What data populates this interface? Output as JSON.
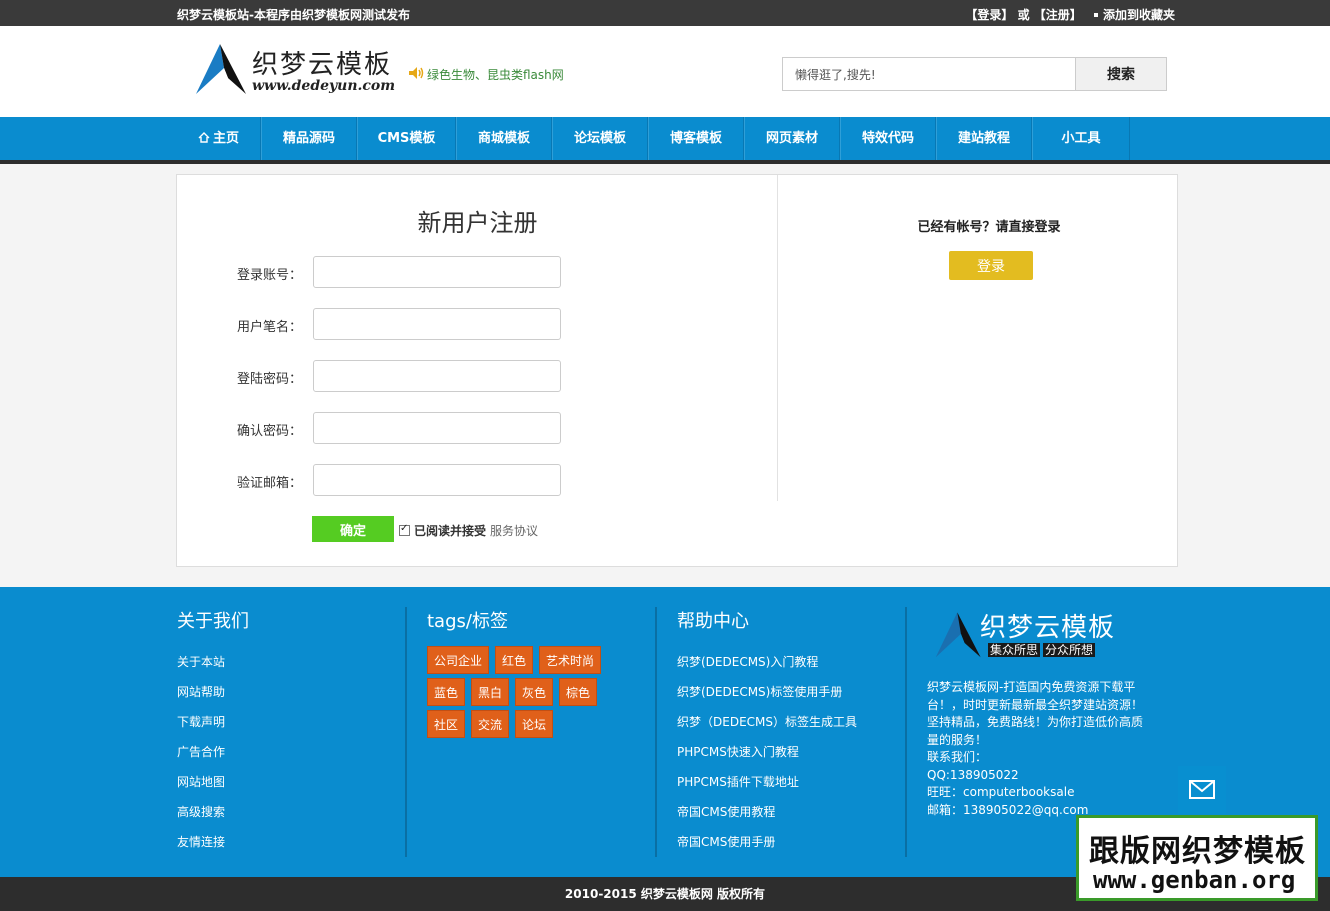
{
  "topbar": {
    "notice": "织梦云模板站-本程序由织梦模板网测试发布",
    "login": "【登录】",
    "or": "或",
    "register": "【注册】",
    "bookmark": "添加到收藏夹"
  },
  "header": {
    "logo_cn": "织梦云模板",
    "logo_en": "www.dedeyun.com",
    "marquee": "绿色生物、昆虫类flash网",
    "search_value": "懒得逛了,搜先!",
    "search_button": "搜索"
  },
  "nav": {
    "items": [
      {
        "label": "主页"
      },
      {
        "label": "精品源码"
      },
      {
        "label": "CMS模板"
      },
      {
        "label": "商城模板"
      },
      {
        "label": "论坛模板"
      },
      {
        "label": "博客模板"
      },
      {
        "label": "网页素材"
      },
      {
        "label": "特效代码"
      },
      {
        "label": "建站教程"
      },
      {
        "label": "小工具"
      }
    ]
  },
  "register": {
    "title": "新用户注册",
    "fields": [
      {
        "label": "登录账号："
      },
      {
        "label": "用户笔名："
      },
      {
        "label": "登陆密码："
      },
      {
        "label": "确认密码："
      },
      {
        "label": "验证邮箱："
      }
    ],
    "submit": "确定",
    "agree": "已阅读并接受",
    "tos": "服务协议"
  },
  "login": {
    "question": "已经有帐号？请直接登录",
    "button": "登录"
  },
  "footer": {
    "about": {
      "title": "关于我们",
      "links": [
        "关于本站",
        "网站帮助",
        "下载声明",
        "广告合作",
        "网站地图",
        "高级搜索",
        "友情连接"
      ]
    },
    "tags": {
      "title": "tags/标签",
      "items": [
        "公司企业",
        "红色",
        "艺术时尚",
        "蓝色",
        "黑白",
        "灰色",
        "棕色",
        "社区",
        "交流",
        "论坛"
      ]
    },
    "help": {
      "title": "帮助中心",
      "links": [
        "织梦(DEDECMS)入门教程",
        "织梦(DEDECMS)标签使用手册",
        "织梦（DEDECMS）标签生成工具",
        "PHPCMS快速入门教程",
        "PHPCMS插件下载地址",
        "帝国CMS使用教程",
        "帝国CMS使用手册"
      ]
    },
    "brand": {
      "logo_cn": "织梦云模板",
      "slogan_a": "集众所思",
      "slogan_b": "分众所想",
      "lines": [
        "织梦云模板网-打造国内免费资源下载平台！，时时更新最新最全织梦建站资源！坚持精品，免费路线！为你打造低价高质量的服务！",
        "联系我们：",
        "QQ:138905022",
        "旺旺：computerbooksale",
        "邮箱：138905022@qq.com"
      ]
    }
  },
  "watermark": {
    "line1": "跟版网织梦模板",
    "line2": "www.genban.org"
  },
  "copyright": "2010-2015 织梦云模板网 版权所有",
  "colors": {
    "nav_blue": "#0a8ccf",
    "dark": "#2d2d2d",
    "submit_green": "#55cc22",
    "login_yellow": "#e3bc20",
    "tag_orange": "#e0601a"
  }
}
